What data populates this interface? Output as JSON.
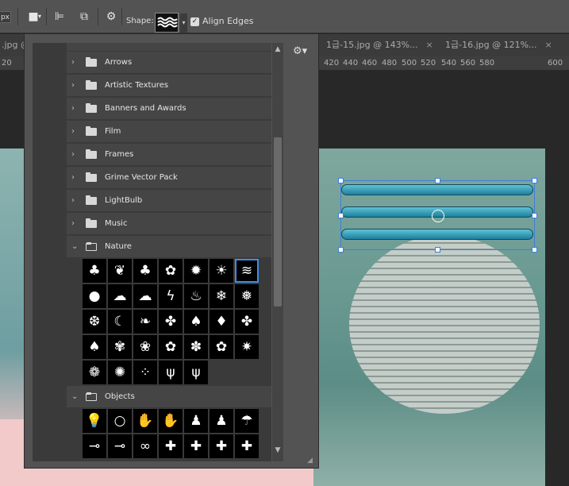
{
  "options_bar": {
    "unit": "px",
    "shape_label": "Shape:",
    "align_label": "Align Edges",
    "align_checked": true
  },
  "tabs": [
    {
      "label": ".jpg @",
      "close": "×"
    },
    {
      "label": "1급-15.jpg @ 143%...",
      "close": "×"
    },
    {
      "label": "1급-16.jpg @ 121%...",
      "close": "×"
    }
  ],
  "ruler_ticks": [
    "20",
    "420",
    "440",
    "460",
    "480",
    "500",
    "520",
    "540",
    "560",
    "580",
    "600"
  ],
  "shape_picker": {
    "folders": [
      {
        "label": "Arrows",
        "open": false
      },
      {
        "label": "Artistic Textures",
        "open": false
      },
      {
        "label": "Banners and Awards",
        "open": false
      },
      {
        "label": "Film",
        "open": false
      },
      {
        "label": "Frames",
        "open": false
      },
      {
        "label": "Grime Vector Pack",
        "open": false
      },
      {
        "label": "LightBulb",
        "open": false
      },
      {
        "label": "Music",
        "open": false
      },
      {
        "label": "Nature",
        "open": true
      },
      {
        "label": "Objects",
        "open": true
      }
    ],
    "nature_shapes": [
      "tree",
      "fern",
      "shamrock",
      "butterfly",
      "sun-rays",
      "sun",
      "waves",
      "raindrop",
      "cloud",
      "cloud-outline",
      "lightning",
      "fire",
      "snowflake",
      "snowflake-2",
      "snowflake-3",
      "crescent-moon",
      "leaf",
      "maple-leaf",
      "leaf-2",
      "leaf-3",
      "maple-leaf-2",
      "leaf-4",
      "leaf-5",
      "flower",
      "flower-2",
      "flower-3",
      "clover",
      "starburst",
      "daisy",
      "daisy-2",
      "grass-texture",
      "grass",
      "grass-2"
    ],
    "nature_glyphs": [
      "♣",
      "❦",
      "♣",
      "✿",
      "✹",
      "☀",
      "≋",
      "●",
      "☁",
      "☁",
      "ϟ",
      "♨",
      "❄",
      "❅",
      "❆",
      "☾",
      "❧",
      "✤",
      "♠",
      "♦",
      "✤",
      "♠",
      "✾",
      "❀",
      "✿",
      "✽",
      "✿",
      "✷",
      "❁",
      "✺",
      "⁘",
      "ψ",
      "ψ"
    ],
    "selected_shape": "waves",
    "object_shapes": [
      "lightbulb",
      "lightbulb-outline",
      "hand",
      "hand-outline",
      "footprint",
      "footprint-2",
      "umbrella",
      "key",
      "key-2",
      "bow",
      "puzzle",
      "puzzle-2",
      "puzzle-3",
      "puzzle-4"
    ],
    "object_glyphs": [
      "💡",
      "○",
      "✋",
      "✋",
      "♟",
      "♟",
      "☂",
      "⊸",
      "⊸",
      "∞",
      "✚",
      "✚",
      "✚",
      "✚"
    ]
  },
  "colors": {
    "accent": "#3d8ee6",
    "panel_bg": "#535353",
    "selection": "#3d7fd8"
  }
}
